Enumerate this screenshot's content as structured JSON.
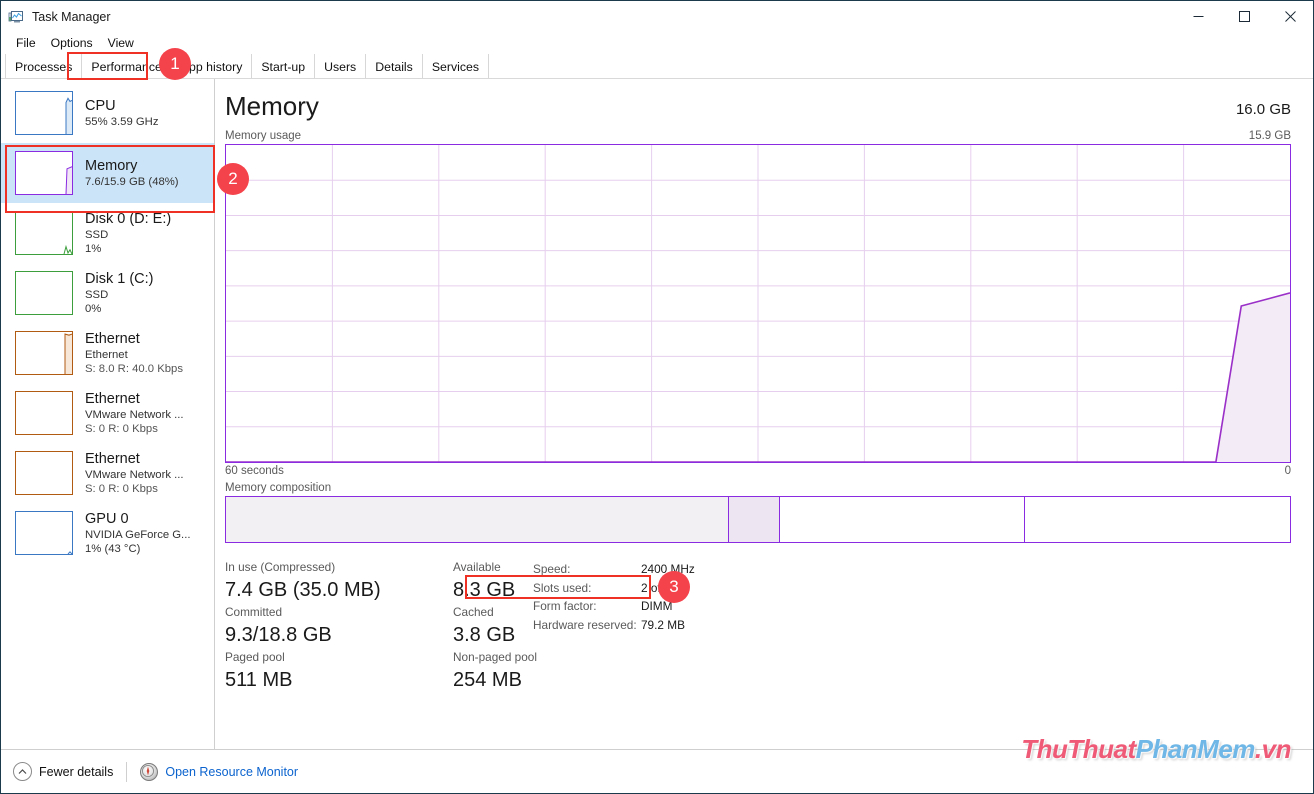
{
  "window": {
    "title": "Task Manager",
    "icon": "task-manager-icon",
    "controls": {
      "minimize": "—",
      "maximize": "☐",
      "close": "✕"
    }
  },
  "menubar": {
    "items": [
      "File",
      "Options",
      "View"
    ]
  },
  "tabs": {
    "items": [
      {
        "label": "Processes",
        "active": false
      },
      {
        "label": "Performance",
        "active": true
      },
      {
        "label": "App history",
        "active": false
      },
      {
        "label": "Start-up",
        "active": false
      },
      {
        "label": "Users",
        "active": false
      },
      {
        "label": "Details",
        "active": false
      },
      {
        "label": "Services",
        "active": false
      }
    ]
  },
  "sidebar": {
    "items": [
      {
        "title": "CPU",
        "sub1": "55%  3.59 GHz",
        "sub2": "",
        "color": "blue",
        "selected": false
      },
      {
        "title": "Memory",
        "sub1": "7.6/15.9 GB (48%)",
        "sub2": "",
        "color": "purple",
        "selected": true
      },
      {
        "title": "Disk 0 (D: E:)",
        "sub1": "SSD",
        "sub2": "1%",
        "color": "green",
        "selected": false
      },
      {
        "title": "Disk 1 (C:)",
        "sub1": "SSD",
        "sub2": "0%",
        "color": "green",
        "selected": false
      },
      {
        "title": "Ethernet",
        "sub1": "Ethernet",
        "sub2": "S: 8.0 R: 40.0 Kbps",
        "color": "orange",
        "selected": false
      },
      {
        "title": "Ethernet",
        "sub1": "VMware Network ...",
        "sub2": "S: 0 R: 0 Kbps",
        "color": "orange",
        "selected": false
      },
      {
        "title": "Ethernet",
        "sub1": "VMware Network ...",
        "sub2": "S: 0 R: 0 Kbps",
        "color": "orange",
        "selected": false
      },
      {
        "title": "GPU 0",
        "sub1": "NVIDIA GeForce G...",
        "sub2": "1%  (43 °C)",
        "color": "blue",
        "selected": false
      }
    ]
  },
  "main": {
    "title": "Memory",
    "total": "16.0 GB",
    "graph_label": "Memory usage",
    "graph_max": "15.9 GB",
    "time_label": "60 seconds",
    "time_right": "0",
    "composition_label": "Memory composition"
  },
  "stats": {
    "left": [
      {
        "caption": "In use (Compressed)",
        "value": "7.4 GB (35.0 MB)"
      },
      {
        "caption": "Committed",
        "value": "9.3/18.8 GB"
      },
      {
        "caption": "Paged pool",
        "value": "511 MB"
      }
    ],
    "mid": [
      {
        "caption": "Available",
        "value": "8.3 GB"
      },
      {
        "caption": "Cached",
        "value": "3.8 GB"
      },
      {
        "caption": "Non-paged pool",
        "value": "254 MB"
      }
    ],
    "right": [
      {
        "key": "Speed:",
        "value": "2400 MHz"
      },
      {
        "key": "Slots used:",
        "value": "2 of 2"
      },
      {
        "key": "Form factor:",
        "value": "DIMM"
      },
      {
        "key": "Hardware reserved:",
        "value": "79.2 MB"
      }
    ]
  },
  "statusbar": {
    "fewer_details": "Fewer details",
    "resource_monitor": "Open Resource Monitor"
  },
  "watermark": {
    "part1": "ThuThuat",
    "part2": "PhanMem",
    "part3": ".vn"
  },
  "annotations": {
    "badges": [
      {
        "number": "1"
      },
      {
        "number": "2"
      },
      {
        "number": "3"
      }
    ]
  },
  "chart_data": {
    "type": "area",
    "title": "Memory usage",
    "ylabel": "",
    "xlabel": "60 seconds",
    "ylim": [
      0,
      15.9
    ],
    "xlim": [
      60,
      0
    ],
    "grid": true,
    "x": [
      60,
      57,
      54,
      51,
      48,
      45,
      42,
      39,
      36,
      33,
      30,
      27,
      24,
      21,
      18,
      15,
      12,
      9,
      6,
      3,
      2,
      1,
      0
    ],
    "values": [
      0,
      0,
      0,
      0,
      0,
      0,
      0,
      0,
      0,
      0,
      0,
      0,
      0,
      0,
      0,
      0,
      0,
      0,
      0,
      0,
      0,
      7.6,
      7.9
    ],
    "series_color": "#8a2be2",
    "fill_color": "#f3ecf6"
  }
}
